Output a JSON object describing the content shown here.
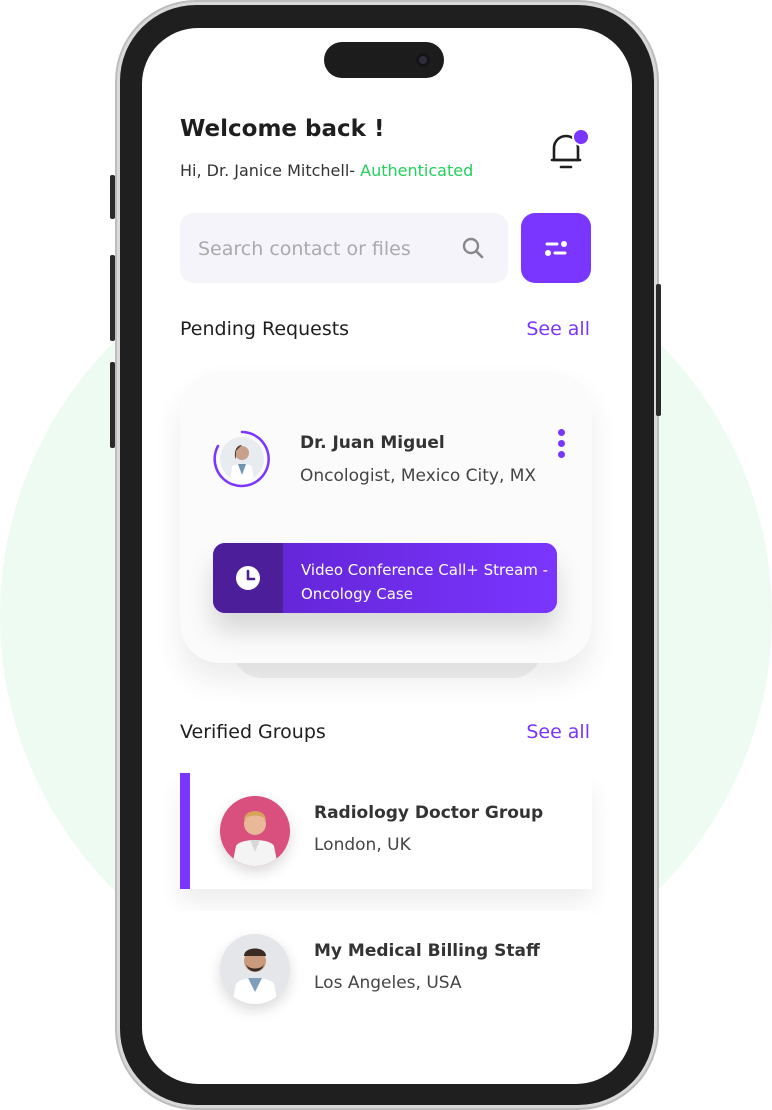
{
  "header": {
    "welcome": "Welcome back !",
    "greeting": "Hi, Dr. Janice Mitchell-",
    "status": "Authenticated"
  },
  "search": {
    "placeholder": "Search contact or files"
  },
  "pending": {
    "title": "Pending Requests",
    "see_all": "See all",
    "request": {
      "name": "Dr. Juan Miguel",
      "role": "Oncologist, Mexico City, MX",
      "call_text": "Video Conference Call+ Stream -Oncology Case"
    }
  },
  "groups": {
    "title": "Verified Groups",
    "see_all": "See all",
    "items": [
      {
        "name": "Radiology Doctor Group",
        "location": "London, UK"
      },
      {
        "name": "My Medical Billing Staff",
        "location": "Los Angeles, USA"
      }
    ]
  },
  "colors": {
    "accent": "#7a35ff",
    "authenticated": "#22d05a",
    "background_circle": "#eefbf2"
  },
  "icons": [
    "bell-icon",
    "notification-dot",
    "search-icon",
    "filter-icon",
    "kebab-menu-icon",
    "clock-icon"
  ]
}
